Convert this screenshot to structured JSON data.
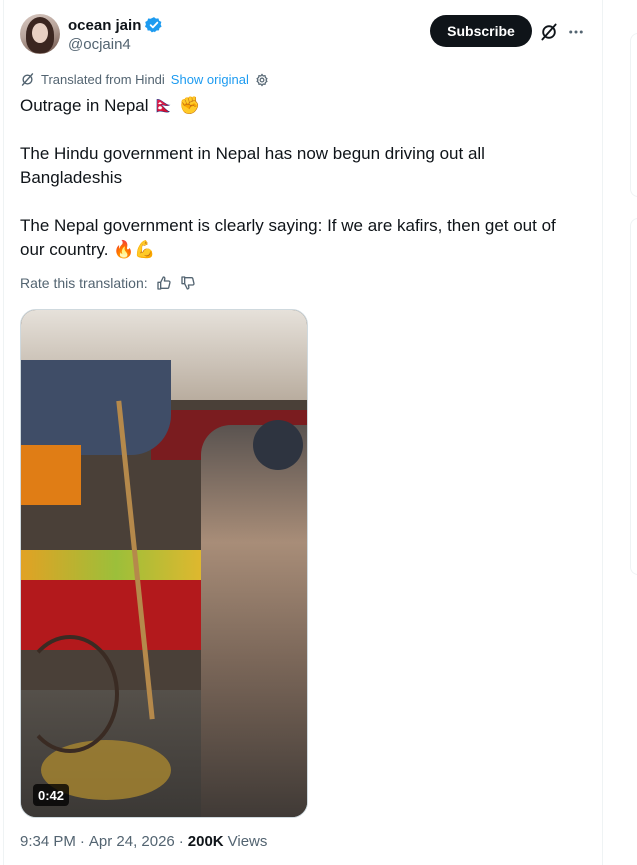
{
  "author": {
    "name": "ocean jain",
    "handle": "@ocjain4",
    "verified": true,
    "verified_color": "#1d9bf0"
  },
  "actions": {
    "subscribe_label": "Subscribe",
    "grok_icon": "grok-icon",
    "more_icon": "more-icon"
  },
  "translation": {
    "notice": "Translated from Hindi",
    "show_original": "Show original",
    "rate_label": "Rate this translation:"
  },
  "tweet": {
    "line1": "Outrage in Nepal 🇳🇵 ✊",
    "line2": "The Hindu government in Nepal has now begun driving out all\nBangladeshis",
    "line3": "The Nepal government is clearly saying: If we are kafirs, then get out of\nour country. 🔥💪"
  },
  "media": {
    "duration": "0:42"
  },
  "meta": {
    "time": "9:34 PM",
    "separator": "·",
    "date": "Apr 24, 2026",
    "views_count": "200K",
    "views_label": "Views"
  }
}
